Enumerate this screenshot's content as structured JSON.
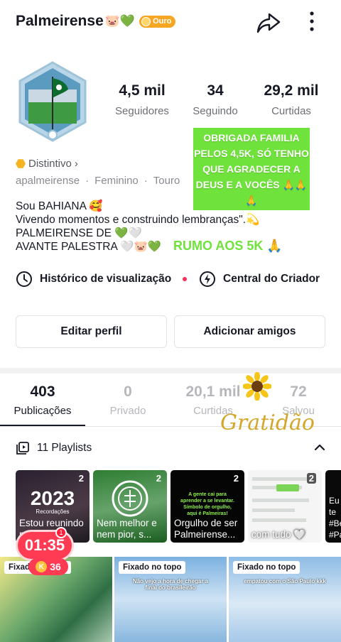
{
  "header": {
    "username": "Palmeirense",
    "username_emoji": "🐷💚",
    "badge_label": "Ouro"
  },
  "stats": [
    {
      "value": "4,5 mil",
      "label": "Seguidores"
    },
    {
      "value": "34",
      "label": "Seguindo"
    },
    {
      "value": "29,2 mil",
      "label": "Curtidas"
    }
  ],
  "overlay_message": "OBRIGADA FAMILIA PELOS 4,5K, SÓ TENHO QUE AGRADECER A DEUS E A VOCÊS 🙏🙏🙏",
  "distintivo_label": "Distintivo",
  "meta": {
    "handle": "apalmeirense",
    "gender": "Feminino",
    "sign": "Touro"
  },
  "bio": [
    "Sou BAHIANA 🥰",
    "Vivendo momentos e construindo lembranças\".💫",
    "PALMEIRENSE DE 💚🤍",
    "AVANTE PALESTRA 🤍🐷💚"
  ],
  "overlay_rumo": "RUMO AOS 5K 🙏",
  "quick_links": {
    "history": "Histórico de visualização",
    "creator": "Central do Criador"
  },
  "buttons": {
    "edit": "Editar perfil",
    "add_friends": "Adicionar amigos"
  },
  "tabs": [
    {
      "value": "403",
      "label": "Publicações"
    },
    {
      "value": "0",
      "label": "Privado"
    },
    {
      "value": "20,1 mil",
      "label": "Curtidas"
    },
    {
      "value": "72",
      "label": "Salvou"
    }
  ],
  "overlay_gratidao": "Gratidão",
  "playlists": {
    "label": "11 Playlists",
    "items": [
      {
        "title": "Estou reunindo m...",
        "count": "2",
        "thumb_text": "2023",
        "thumb_sub": "Recordações"
      },
      {
        "title": "Nem melhor e nem pior, s...",
        "count": "2"
      },
      {
        "title": "Orgulho de ser Palmeirense...",
        "count": "2",
        "thumb_text": "A gente cai para aprender a se levantar. Símbolo de orgulho, aqui é Palmeiras!"
      },
      {
        "title": "com tudo 🤍",
        "count": "2"
      },
      {
        "title": "Eu te #Be #Pa",
        "count": ""
      }
    ]
  },
  "videos": [
    {
      "pin": "Fixado no topo",
      "caption": ""
    },
    {
      "pin": "Fixado no topo",
      "caption": "Não vejo a hora de chegar a final do brasileirão"
    },
    {
      "pin": "Fixado no topo",
      "caption": "empatou com o São Paulo kkk"
    }
  ],
  "timer": {
    "time": "01:35",
    "coins": "36",
    "notification": "1"
  },
  "colors": {
    "accent_red": "#fe2c55",
    "overlay_green": "#6fe23b",
    "gold": "#f5a623"
  }
}
